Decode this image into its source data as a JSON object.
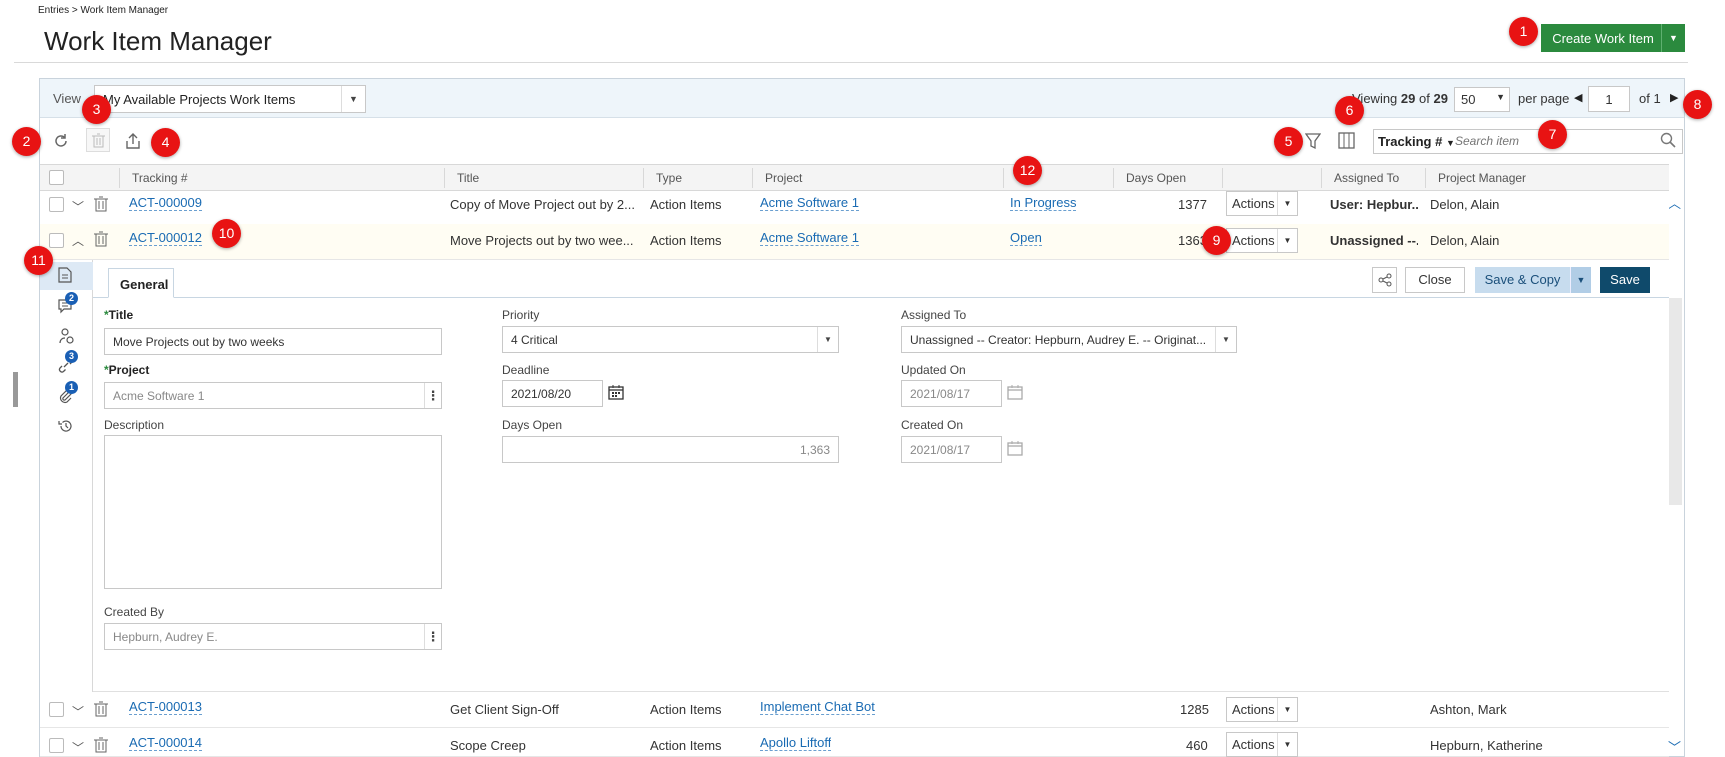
{
  "breadcrumb": "Entries > Work Item Manager",
  "page_title": "Work Item Manager",
  "create_button": "Create Work Item",
  "view": {
    "label": "View",
    "selected": "My Available Projects Work Items",
    "viewing_prefix": "Viewing",
    "viewing_shown": "29",
    "viewing_of": "of",
    "viewing_total": "29",
    "per_page_value": "50",
    "per_page_label": "per page",
    "page": "1",
    "of_pages": "of 1"
  },
  "search": {
    "field": "Tracking #",
    "placeholder": "Search item"
  },
  "columns": [
    "Tracking #",
    "Title",
    "Type",
    "Project",
    "",
    "Days Open",
    "",
    "Assigned To",
    "Project Manager"
  ],
  "rows": [
    {
      "tracking": "ACT-000009",
      "title": "Copy of Move Project out by 2...",
      "type": "Action Items",
      "project": "Acme Software 1",
      "status": "In Progress",
      "days_open": "1377",
      "actions": "Actions",
      "assigned": "User: Hepbur...",
      "pm": "Delon, Alain"
    },
    {
      "tracking": "ACT-000012",
      "title": "Move Projects out by two wee...",
      "type": "Action Items",
      "project": "Acme Software 1",
      "status": "Open",
      "days_open": "1363",
      "actions": "Actions",
      "assigned": "Unassigned --...",
      "pm": "Delon, Alain"
    },
    {
      "tracking": "ACT-000013",
      "title": "Get Client Sign-Off",
      "type": "Action Items",
      "project": "Implement Chat Bot",
      "status": "",
      "days_open": "1285",
      "actions": "Actions",
      "assigned": "",
      "pm": "Ashton, Mark"
    },
    {
      "tracking": "ACT-000014",
      "title": "Scope Creep",
      "type": "Action Items",
      "project": "Apollo Liftoff",
      "status": "",
      "days_open": "460",
      "actions": "Actions",
      "assigned": "",
      "pm": "Hepburn, Katherine"
    }
  ],
  "detail": {
    "tab": "General",
    "badges": {
      "comments": "2",
      "links": "3",
      "attachments": "1"
    },
    "buttons": {
      "close": "Close",
      "save_copy": "Save & Copy",
      "save": "Save"
    },
    "title_label": "Title",
    "title_value": "Move Projects out by two weeks",
    "project_label": "Project",
    "project_value": "Acme Software 1",
    "description_label": "Description",
    "created_by_label": "Created By",
    "created_by_value": "Hepburn, Audrey E.",
    "priority_label": "Priority",
    "priority_value": "4 Critical",
    "deadline_label": "Deadline",
    "deadline_value": "2021/08/20",
    "days_open_label": "Days Open",
    "days_open_value": "1,363",
    "assigned_label": "Assigned To",
    "assigned_value": "Unassigned -- Creator: Hepburn, Audrey E. -- Originat...",
    "updated_label": "Updated On",
    "updated_value": "2021/08/17",
    "created_on_label": "Created On",
    "created_on_value": "2021/08/17"
  },
  "callouts": [
    "1",
    "2",
    "3",
    "4",
    "5",
    "6",
    "7",
    "8",
    "9",
    "10",
    "11",
    "12"
  ],
  "colors": {
    "create_green": "#2b8a3e",
    "link_blue": "#1a6bb3",
    "save_navy": "#0f4a6b",
    "callout_red": "#e81313"
  }
}
